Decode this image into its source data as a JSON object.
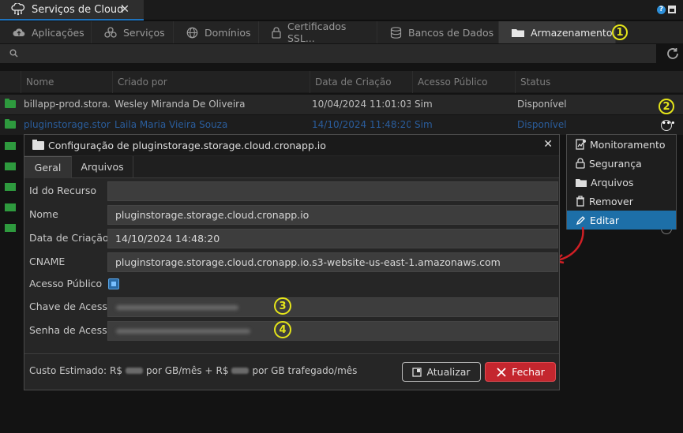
{
  "window": {
    "tab_title": "Serviços de Cloud",
    "close_glyph": "✕",
    "help_glyph": "?"
  },
  "service_tabs": [
    {
      "label": "Aplicações",
      "icon": "cloud-upload-icon"
    },
    {
      "label": "Serviços",
      "icon": "cubes-icon"
    },
    {
      "label": "Domínios",
      "icon": "globe-icon"
    },
    {
      "label": "Certificados SSL...",
      "icon": "lock-icon"
    },
    {
      "label": "Bancos de Dados",
      "icon": "database-icon"
    },
    {
      "label": "Armazenamento",
      "icon": "folder-icon",
      "active": true
    }
  ],
  "annotations": [
    "1",
    "2",
    "3",
    "4"
  ],
  "table": {
    "headers": [
      "Nome",
      "Criado por",
      "Data de Criação",
      "Acesso Público",
      "Status"
    ],
    "rows": [
      [
        "billapp-prod.stora...",
        "Wesley Miranda De Oliveira",
        "10/04/2024 11:01:03",
        "Sim",
        "Disponível"
      ],
      [
        "pluginstorage.stor...",
        "Laila Maria Vieira Souza",
        "14/10/2024 11:48:20",
        "Sim",
        "Disponível"
      ]
    ]
  },
  "context_menu": {
    "items": [
      {
        "label": "Monitoramento",
        "icon": "monitor-icon"
      },
      {
        "label": "Segurança",
        "icon": "lock-icon"
      },
      {
        "label": "Arquivos",
        "icon": "folder-icon"
      },
      {
        "label": "Remover",
        "icon": "trash-icon"
      },
      {
        "label": "Editar",
        "icon": "pencil-icon",
        "highlighted": true
      }
    ]
  },
  "dialog": {
    "title": "Configuração de pluginstorage.storage.cloud.cronapp.io",
    "tabs": [
      "Geral",
      "Arquivos"
    ],
    "fields": {
      "resource_id": {
        "label": "Id do Recurso",
        "value": ""
      },
      "name": {
        "label": "Nome",
        "value": "pluginstorage.storage.cloud.cronapp.io"
      },
      "created": {
        "label": "Data de Criação",
        "value": "14/10/2024 14:48:20"
      },
      "cname": {
        "label": "CNAME",
        "value": "pluginstorage.storage.cloud.cronapp.io.s3-website-us-east-1.amazonaws.com"
      },
      "public": {
        "label": "Acesso Público",
        "checked": true
      },
      "access_key": {
        "label": "Chave de Acesso"
      },
      "secret_key": {
        "label": "Senha de Acesso"
      }
    },
    "cost": {
      "prefix": "Custo Estimado:",
      "currency1": "R$",
      "per_gb_month": "por GB/mês +",
      "currency2": "R$",
      "per_gb_traffic": "por GB trafegado/mês"
    },
    "buttons": {
      "update": "Atualizar",
      "close": "Fechar"
    }
  },
  "colors": {
    "accent_blue": "#1d6fa8",
    "danger_red": "#c4262e",
    "annotation_yellow": "#e5e51a",
    "folder_green": "#2e9a3e"
  }
}
